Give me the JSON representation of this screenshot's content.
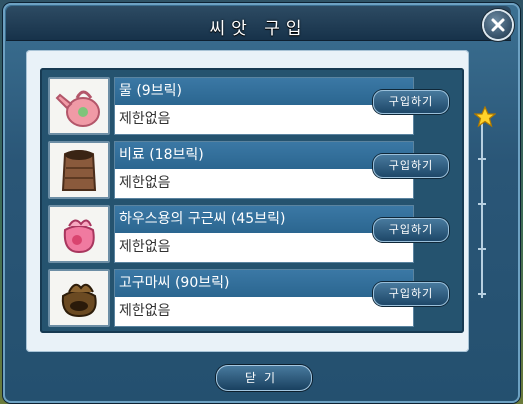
{
  "window": {
    "title": "씨앗 구입"
  },
  "items": [
    {
      "name": "물 (9브릭)",
      "limit": "제한없음",
      "buy_label": "구입하기",
      "icon": "watering-can-icon"
    },
    {
      "name": "비료 (18브릭)",
      "limit": "제한없음",
      "buy_label": "구입하기",
      "icon": "fertilizer-bag-icon"
    },
    {
      "name": "하우스용의 구근씨 (45브릭)",
      "limit": "제한없음",
      "buy_label": "구입하기",
      "icon": "bulb-seed-bag-icon"
    },
    {
      "name": "고구마씨 (90브릭)",
      "limit": "제한없음",
      "buy_label": "구입하기",
      "icon": "sweet-potato-seed-bag-icon"
    }
  ],
  "footer": {
    "close_label": "닫기"
  },
  "colors": {
    "accent": "#2b6690",
    "panel": "#e9f2f8"
  }
}
